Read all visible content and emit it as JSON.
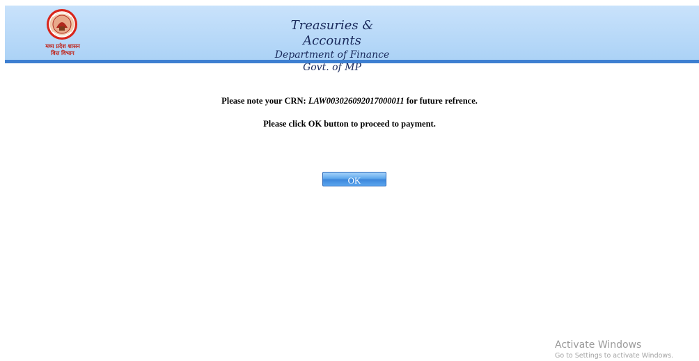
{
  "header": {
    "title": "Treasuries & Accounts",
    "department": "Department of Finance",
    "government": "Govt. of MP",
    "emblem_caption_line1": "मध्य प्रदेश शासन",
    "emblem_caption_line2": "वित्त विभाग",
    "emblem_icon": "state-emblem-icon",
    "background_color": "#abd2f6",
    "bar_color": "#3d7fd1"
  },
  "message": {
    "crn_prefix": "Please note your CRN:",
    "crn_value": "LAW003026092017000011",
    "crn_suffix": "for future refrence.",
    "instruction": "Please click OK button to proceed to payment."
  },
  "actions": {
    "ok_label": "OK"
  },
  "watermark": {
    "title": "Activate Windows",
    "subtitle": "Go to Settings to activate Windows."
  }
}
